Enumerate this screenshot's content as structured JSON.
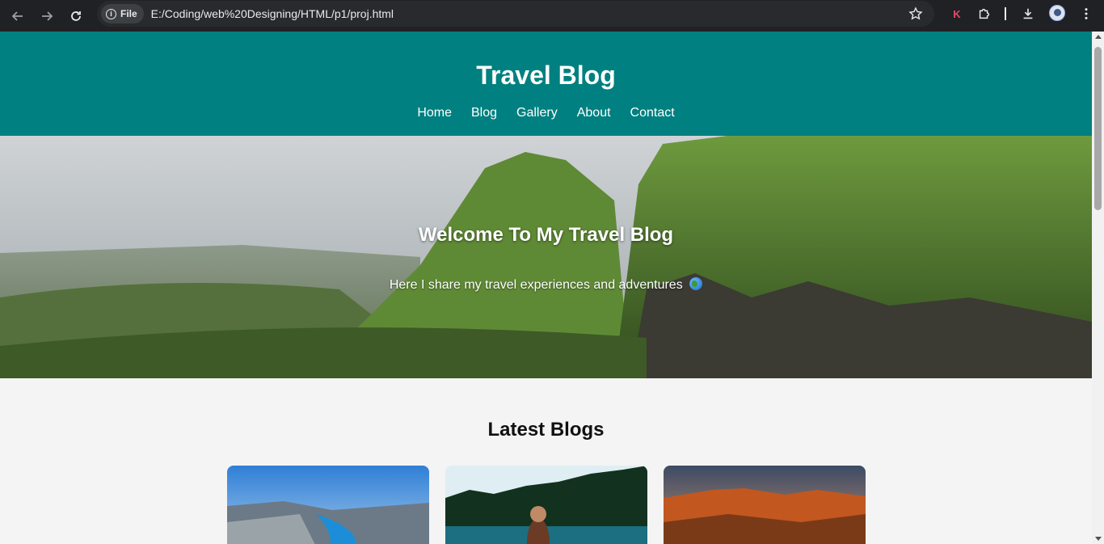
{
  "browser": {
    "chip_label": "File",
    "url": "E:/Coding/web%20Designing/HTML/p1/proj.html",
    "extension_letter": "K"
  },
  "site": {
    "title": "Travel Blog",
    "nav": [
      "Home",
      "Blog",
      "Gallery",
      "About",
      "Contact"
    ],
    "accent_color": "#008080"
  },
  "hero": {
    "heading": "Welcome To My Travel Blog",
    "subtext": "Here I share my travel experiences and adventures"
  },
  "latest": {
    "heading": "Latest Blogs"
  }
}
